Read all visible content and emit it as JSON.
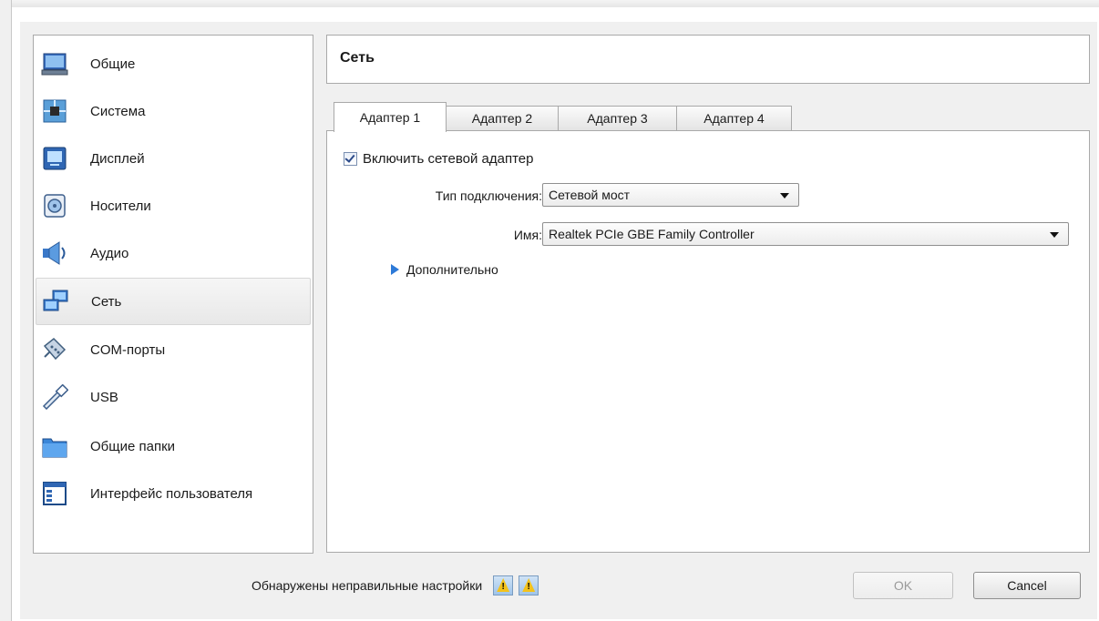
{
  "sidebar": {
    "items": [
      {
        "label": "Общие",
        "icon": "general-icon"
      },
      {
        "label": "Система",
        "icon": "system-icon"
      },
      {
        "label": "Дисплей",
        "icon": "display-icon"
      },
      {
        "label": "Носители",
        "icon": "storage-icon"
      },
      {
        "label": "Аудио",
        "icon": "audio-icon"
      },
      {
        "label": "Сеть",
        "icon": "network-icon",
        "selected": true
      },
      {
        "label": "COM-порты",
        "icon": "serial-port-icon"
      },
      {
        "label": "USB",
        "icon": "usb-icon"
      },
      {
        "label": "Общие папки",
        "icon": "shared-folders-icon"
      },
      {
        "label": "Интерфейс пользователя",
        "icon": "user-interface-icon"
      }
    ]
  },
  "header": {
    "title": "Сеть"
  },
  "tabs": [
    {
      "label": "Адаптер 1",
      "active": true
    },
    {
      "label": "Адаптер 2"
    },
    {
      "label": "Адаптер 3"
    },
    {
      "label": "Адаптер 4"
    }
  ],
  "adapter": {
    "enable_label": "Включить сетевой адаптер",
    "enabled": true,
    "connection_type_label": "Тип подключения:",
    "connection_type_value": "Сетевой мост",
    "name_label": "Имя:",
    "name_value": "Realtek PCIe GBE Family Controller",
    "advanced_label": "Дополнительно"
  },
  "footer": {
    "warning_text": "Обнаружены неправильные настройки",
    "ok_label": "OK",
    "cancel_label": "Cancel"
  },
  "colors": {
    "dialog_bg": "#f0f0f0",
    "accent_blue": "#2d7ad8",
    "warning_yellow": "#f3c21b"
  }
}
